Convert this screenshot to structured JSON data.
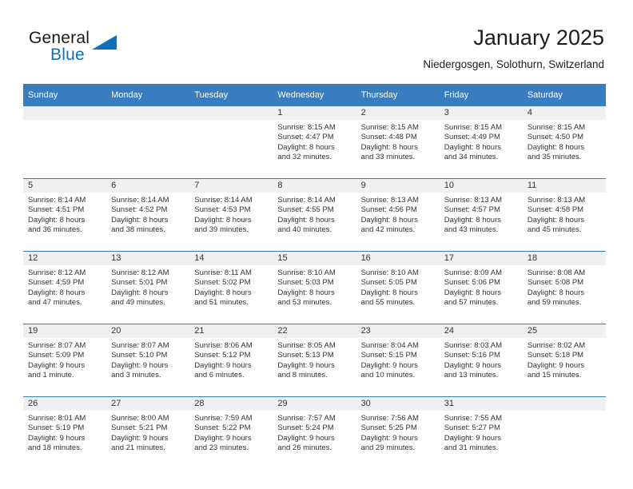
{
  "brand": {
    "name_part1": "General",
    "name_part2": "Blue",
    "accent_color": "#0d6fbd",
    "triangle_icon": "triangle-icon"
  },
  "header": {
    "title": "January 2025",
    "location": "Niedergosgen, Solothurn, Switzerland"
  },
  "calendar": {
    "header_color": "#3a7cc0",
    "daybar_color": "#f0f0f0",
    "weekday_headers": [
      "Sunday",
      "Monday",
      "Tuesday",
      "Wednesday",
      "Thursday",
      "Friday",
      "Saturday"
    ],
    "weeks": [
      [
        {
          "day": "",
          "empty": true
        },
        {
          "day": "",
          "empty": true
        },
        {
          "day": "",
          "empty": true
        },
        {
          "day": "1",
          "sunrise": "Sunrise: 8:15 AM",
          "sunset": "Sunset: 4:47 PM",
          "daylight1": "Daylight: 8 hours",
          "daylight2": "and 32 minutes."
        },
        {
          "day": "2",
          "sunrise": "Sunrise: 8:15 AM",
          "sunset": "Sunset: 4:48 PM",
          "daylight1": "Daylight: 8 hours",
          "daylight2": "and 33 minutes."
        },
        {
          "day": "3",
          "sunrise": "Sunrise: 8:15 AM",
          "sunset": "Sunset: 4:49 PM",
          "daylight1": "Daylight: 8 hours",
          "daylight2": "and 34 minutes."
        },
        {
          "day": "4",
          "sunrise": "Sunrise: 8:15 AM",
          "sunset": "Sunset: 4:50 PM",
          "daylight1": "Daylight: 8 hours",
          "daylight2": "and 35 minutes."
        }
      ],
      [
        {
          "day": "5",
          "sunrise": "Sunrise: 8:14 AM",
          "sunset": "Sunset: 4:51 PM",
          "daylight1": "Daylight: 8 hours",
          "daylight2": "and 36 minutes."
        },
        {
          "day": "6",
          "sunrise": "Sunrise: 8:14 AM",
          "sunset": "Sunset: 4:52 PM",
          "daylight1": "Daylight: 8 hours",
          "daylight2": "and 38 minutes."
        },
        {
          "day": "7",
          "sunrise": "Sunrise: 8:14 AM",
          "sunset": "Sunset: 4:53 PM",
          "daylight1": "Daylight: 8 hours",
          "daylight2": "and 39 minutes."
        },
        {
          "day": "8",
          "sunrise": "Sunrise: 8:14 AM",
          "sunset": "Sunset: 4:55 PM",
          "daylight1": "Daylight: 8 hours",
          "daylight2": "and 40 minutes."
        },
        {
          "day": "9",
          "sunrise": "Sunrise: 8:13 AM",
          "sunset": "Sunset: 4:56 PM",
          "daylight1": "Daylight: 8 hours",
          "daylight2": "and 42 minutes."
        },
        {
          "day": "10",
          "sunrise": "Sunrise: 8:13 AM",
          "sunset": "Sunset: 4:57 PM",
          "daylight1": "Daylight: 8 hours",
          "daylight2": "and 43 minutes."
        },
        {
          "day": "11",
          "sunrise": "Sunrise: 8:13 AM",
          "sunset": "Sunset: 4:58 PM",
          "daylight1": "Daylight: 8 hours",
          "daylight2": "and 45 minutes."
        }
      ],
      [
        {
          "day": "12",
          "sunrise": "Sunrise: 8:12 AM",
          "sunset": "Sunset: 4:59 PM",
          "daylight1": "Daylight: 8 hours",
          "daylight2": "and 47 minutes."
        },
        {
          "day": "13",
          "sunrise": "Sunrise: 8:12 AM",
          "sunset": "Sunset: 5:01 PM",
          "daylight1": "Daylight: 8 hours",
          "daylight2": "and 49 minutes."
        },
        {
          "day": "14",
          "sunrise": "Sunrise: 8:11 AM",
          "sunset": "Sunset: 5:02 PM",
          "daylight1": "Daylight: 8 hours",
          "daylight2": "and 51 minutes."
        },
        {
          "day": "15",
          "sunrise": "Sunrise: 8:10 AM",
          "sunset": "Sunset: 5:03 PM",
          "daylight1": "Daylight: 8 hours",
          "daylight2": "and 53 minutes."
        },
        {
          "day": "16",
          "sunrise": "Sunrise: 8:10 AM",
          "sunset": "Sunset: 5:05 PM",
          "daylight1": "Daylight: 8 hours",
          "daylight2": "and 55 minutes."
        },
        {
          "day": "17",
          "sunrise": "Sunrise: 8:09 AM",
          "sunset": "Sunset: 5:06 PM",
          "daylight1": "Daylight: 8 hours",
          "daylight2": "and 57 minutes."
        },
        {
          "day": "18",
          "sunrise": "Sunrise: 8:08 AM",
          "sunset": "Sunset: 5:08 PM",
          "daylight1": "Daylight: 8 hours",
          "daylight2": "and 59 minutes."
        }
      ],
      [
        {
          "day": "19",
          "sunrise": "Sunrise: 8:07 AM",
          "sunset": "Sunset: 5:09 PM",
          "daylight1": "Daylight: 9 hours",
          "daylight2": "and 1 minute."
        },
        {
          "day": "20",
          "sunrise": "Sunrise: 8:07 AM",
          "sunset": "Sunset: 5:10 PM",
          "daylight1": "Daylight: 9 hours",
          "daylight2": "and 3 minutes."
        },
        {
          "day": "21",
          "sunrise": "Sunrise: 8:06 AM",
          "sunset": "Sunset: 5:12 PM",
          "daylight1": "Daylight: 9 hours",
          "daylight2": "and 6 minutes."
        },
        {
          "day": "22",
          "sunrise": "Sunrise: 8:05 AM",
          "sunset": "Sunset: 5:13 PM",
          "daylight1": "Daylight: 9 hours",
          "daylight2": "and 8 minutes."
        },
        {
          "day": "23",
          "sunrise": "Sunrise: 8:04 AM",
          "sunset": "Sunset: 5:15 PM",
          "daylight1": "Daylight: 9 hours",
          "daylight2": "and 10 minutes."
        },
        {
          "day": "24",
          "sunrise": "Sunrise: 8:03 AM",
          "sunset": "Sunset: 5:16 PM",
          "daylight1": "Daylight: 9 hours",
          "daylight2": "and 13 minutes."
        },
        {
          "day": "25",
          "sunrise": "Sunrise: 8:02 AM",
          "sunset": "Sunset: 5:18 PM",
          "daylight1": "Daylight: 9 hours",
          "daylight2": "and 15 minutes."
        }
      ],
      [
        {
          "day": "26",
          "sunrise": "Sunrise: 8:01 AM",
          "sunset": "Sunset: 5:19 PM",
          "daylight1": "Daylight: 9 hours",
          "daylight2": "and 18 minutes."
        },
        {
          "day": "27",
          "sunrise": "Sunrise: 8:00 AM",
          "sunset": "Sunset: 5:21 PM",
          "daylight1": "Daylight: 9 hours",
          "daylight2": "and 21 minutes."
        },
        {
          "day": "28",
          "sunrise": "Sunrise: 7:59 AM",
          "sunset": "Sunset: 5:22 PM",
          "daylight1": "Daylight: 9 hours",
          "daylight2": "and 23 minutes."
        },
        {
          "day": "29",
          "sunrise": "Sunrise: 7:57 AM",
          "sunset": "Sunset: 5:24 PM",
          "daylight1": "Daylight: 9 hours",
          "daylight2": "and 26 minutes."
        },
        {
          "day": "30",
          "sunrise": "Sunrise: 7:56 AM",
          "sunset": "Sunset: 5:25 PM",
          "daylight1": "Daylight: 9 hours",
          "daylight2": "and 29 minutes."
        },
        {
          "day": "31",
          "sunrise": "Sunrise: 7:55 AM",
          "sunset": "Sunset: 5:27 PM",
          "daylight1": "Daylight: 9 hours",
          "daylight2": "and 31 minutes."
        },
        {
          "day": "",
          "empty": true
        }
      ]
    ]
  }
}
